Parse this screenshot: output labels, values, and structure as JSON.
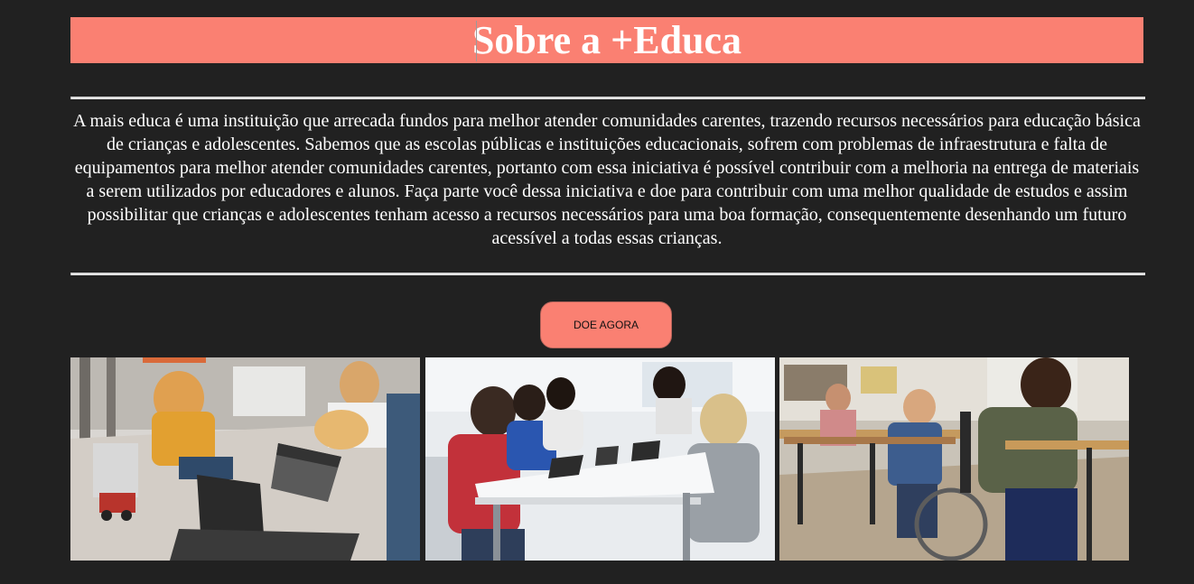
{
  "header": {
    "title": "Sobre a +Educa"
  },
  "about": {
    "text": "A mais educa é uma instituição que arrecada fundos para melhor atender comunidades carentes, trazendo recursos necessários para educação básica de crianças e adolescentes. Sabemos que as escolas públicas e instituições educacionais, sofrem com problemas de infraestrutura e falta de equipamentos para melhor atender comunidades carentes, portanto com essa iniciativa é possível contribuir com a melhoria na entrega de materiais a serem utilizados por educadores e alunos. Faça parte você dessa iniciativa e doe para contribuir com uma melhor qualidade de estudos e assim possibilitar que crianças e adolescentes tenham acesso a recursos necessários para uma boa formação, consequentemente desenhando um futuro acessível a todas essas crianças."
  },
  "cta": {
    "donate_label": "DOE AGORA"
  },
  "colors": {
    "background": "#212121",
    "accent": "#fa8072",
    "text": "#ffffff",
    "divider": "#d9d9d9"
  },
  "gallery": {
    "images": [
      {
        "subject": "children-robotics-laptops-photo"
      },
      {
        "subject": "students-tablets-classroom-photo"
      },
      {
        "subject": "students-writing-classroom-wheelchair-photo"
      }
    ]
  }
}
